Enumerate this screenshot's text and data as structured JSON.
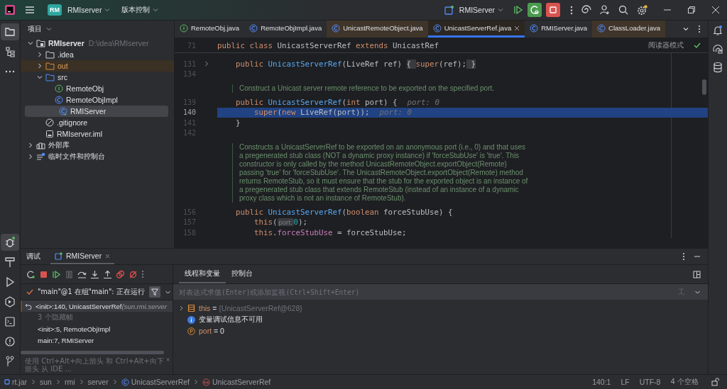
{
  "title_bar": {
    "project_badge": "RM",
    "project": "RMIserver",
    "vcs": "版本控制",
    "run_config": "RMIServer"
  },
  "project_panel": {
    "title": "项目",
    "tree": [
      {
        "name": "RMIserver",
        "path": "D:\\idea\\RMIserver",
        "kind": "module",
        "expanded": true,
        "selected": false,
        "children": [
          {
            "name": ".idea",
            "kind": "folder",
            "expanded": false,
            "selected": false
          },
          {
            "name": "out",
            "kind": "excluded",
            "expanded": false,
            "selected": false
          },
          {
            "name": "src",
            "kind": "source",
            "expanded": true,
            "selected": false,
            "children": [
              {
                "name": "RemoteObj",
                "kind": "interface",
                "selected": false
              },
              {
                "name": "RemoteObjImpl",
                "kind": "class",
                "selected": false
              },
              {
                "name": "RMIServer",
                "kind": "main",
                "selected": true
              }
            ]
          },
          {
            "name": ".gitignore",
            "kind": "ignore",
            "selected": false
          },
          {
            "name": "RMIserver.iml",
            "kind": "file",
            "selected": false
          }
        ]
      },
      {
        "name": "外部库",
        "kind": "library",
        "expanded": false,
        "selected": false
      },
      {
        "name": "临时文件和控制台",
        "kind": "scratch",
        "expanded": false,
        "selected": false
      }
    ]
  },
  "editor": {
    "tabs": [
      {
        "label": "RemoteObj.java",
        "kind": "interface",
        "library": false,
        "selected": false
      },
      {
        "label": "RemoteObjImpl.java",
        "kind": "class",
        "library": false,
        "selected": false
      },
      {
        "label": "UnicastRemoteObject.java",
        "kind": "class",
        "library": true,
        "selected": false
      },
      {
        "label": "UnicastServerRef.java",
        "kind": "class",
        "library": true,
        "selected": true
      },
      {
        "label": "RMIServer.java",
        "kind": "main",
        "library": false,
        "selected": false
      },
      {
        "label": "ClassLoader.java",
        "kind": "class",
        "library": true,
        "selected": false
      }
    ],
    "reader_mode": "阅读器模式",
    "sticky": {
      "number": "71",
      "tokens": [
        {
          "t": "public class ",
          "kind": "kw"
        },
        {
          "t": "UnicastServerRef ",
          "kind": "plain"
        },
        {
          "t": "extends ",
          "kind": "kw"
        },
        {
          "t": "UnicastRef",
          "kind": "plain"
        }
      ]
    },
    "lines": [
      {
        "kind": "code",
        "number": "131",
        "fold": true,
        "current": false,
        "tokens": [
          {
            "t": "    public ",
            "kind": "kw"
          },
          {
            "t": "UnicastServerRef",
            "kind": "fn"
          },
          {
            "t": "(LiveRef ref) ",
            "kind": "plain"
          },
          {
            "t": "{ ",
            "kind": "folded"
          },
          {
            "t": "super",
            "kind": "kw"
          },
          {
            "t": "(ref);",
            "kind": "plain"
          },
          {
            "t": " }",
            "kind": "folded"
          }
        ]
      },
      {
        "kind": "code",
        "number": "134",
        "fold": false,
        "current": false
      },
      {
        "kind": "doc",
        "text": "Construct a Unicast server remote reference to be exported on the specified port."
      },
      {
        "kind": "code",
        "number": "139",
        "fold": false,
        "current": false,
        "tokens": [
          {
            "t": "    public ",
            "kind": "kw"
          },
          {
            "t": "UnicastServerRef",
            "kind": "fn"
          },
          {
            "t": "(",
            "kind": "plain"
          },
          {
            "t": "int",
            "kind": "kw"
          },
          {
            "t": " port) {",
            "kind": "plain"
          },
          {
            "t": "port: 0",
            "kind": "hint"
          }
        ]
      },
      {
        "kind": "code",
        "number": "140",
        "fold": false,
        "current": true,
        "tokens": [
          {
            "t": "        super",
            "kind": "kw"
          },
          {
            "t": "(",
            "kind": "plain"
          },
          {
            "t": "new ",
            "kind": "kw"
          },
          {
            "t": "LiveRef(port));",
            "kind": "plain"
          },
          {
            "t": "port: 0",
            "kind": "hint"
          }
        ]
      },
      {
        "kind": "code",
        "number": "141",
        "fold": false,
        "current": false,
        "tokens": [
          {
            "t": "    }",
            "kind": "plain"
          }
        ]
      },
      {
        "kind": "code",
        "number": "142",
        "fold": false,
        "current": false
      },
      {
        "kind": "doc",
        "text": "Constructs a UnicastServerRef to be exported on an anonymous port (i.e., 0) and that uses a pregenerated stub class (NOT a dynamic proxy instance) if 'forceStubUse' is 'true'. This constructor is only called by the method UnicastRemoteObject.exportObject(Remote) passing 'true' for 'forceStubUse'. The UnicastRemoteObject.exportObject(Remote) method returns RemoteStub, so it must ensure that the stub for the exported object is an instance of a pregenerated stub class that extends RemoteStub (instead of an instance of a dynamic proxy class which is not an instance of RemoteStub)."
      },
      {
        "kind": "code",
        "number": "156",
        "fold": false,
        "current": false,
        "tokens": [
          {
            "t": "    public ",
            "kind": "kw"
          },
          {
            "t": "UnicastServerRef",
            "kind": "fn"
          },
          {
            "t": "(",
            "kind": "plain"
          },
          {
            "t": "boolean",
            "kind": "kw"
          },
          {
            "t": " forceStubUse) {",
            "kind": "plain"
          }
        ]
      },
      {
        "kind": "code",
        "number": "157",
        "fold": false,
        "current": false,
        "tokens": [
          {
            "t": "        this",
            "kind": "kw"
          },
          {
            "t": "(",
            "kind": "plain"
          },
          {
            "t": "port:",
            "kind": "inlay"
          },
          {
            "t": "0",
            "kind": "num"
          },
          {
            "t": ");",
            "kind": "plain"
          }
        ]
      },
      {
        "kind": "code",
        "number": "158",
        "fold": false,
        "current": false,
        "tokens": [
          {
            "t": "        this",
            "kind": "kw"
          },
          {
            "t": ".",
            "kind": "plain"
          },
          {
            "t": "forceStubUse",
            "kind": "field"
          },
          {
            "t": " = forceStubUse;",
            "kind": "plain"
          }
        ]
      }
    ]
  },
  "debug": {
    "title": "调试",
    "session_tab": "RMIServer",
    "subtabs": [
      {
        "label": "线程和变量",
        "selected": true
      },
      {
        "label": "控制台",
        "selected": false
      }
    ],
    "thread": "\"main\"@1 在组\"main\": 正在运行",
    "frames": [
      {
        "kind": "frame",
        "text": "<init>:140, UnicastServerRef",
        "location": "(sun.rmi.server",
        "selected": true
      },
      {
        "kind": "hidden",
        "text": "3 个隐藏帧",
        "selected": false
      },
      {
        "kind": "frame",
        "text": "<init>:5, RemoteObjImpl",
        "selected": false
      },
      {
        "kind": "frame",
        "text": "main:7, RMIServer",
        "selected": false
      }
    ],
    "hint": "使用 Ctrl+Alt+向上箭头 和 Ctrl+Alt+向下箭头 从 IDE ...",
    "eval_placeholder": "对表达式求值(Enter)或添加监视(Ctrl+Shift+Enter)",
    "variables": [
      {
        "kind": "object",
        "name": "this",
        "op": "=",
        "value": "{UnicastServerRef@628}"
      },
      {
        "kind": "info",
        "text": "变量调试信息不可用"
      },
      {
        "kind": "param",
        "name": "port",
        "op": "=",
        "value": "0"
      }
    ]
  },
  "status_bar": {
    "breadcrumbs": [
      {
        "text": "rt.jar",
        "kind": "jar"
      },
      {
        "text": "sun",
        "kind": "package"
      },
      {
        "text": "rmi",
        "kind": "package"
      },
      {
        "text": "server",
        "kind": "package"
      },
      {
        "text": "UnicastServerRef",
        "kind": "class"
      },
      {
        "text": "UnicastServerRef",
        "kind": "method"
      }
    ],
    "position": "140:1",
    "line_separator": "LF",
    "encoding": "UTF-8",
    "indent": "4 个空格"
  }
}
